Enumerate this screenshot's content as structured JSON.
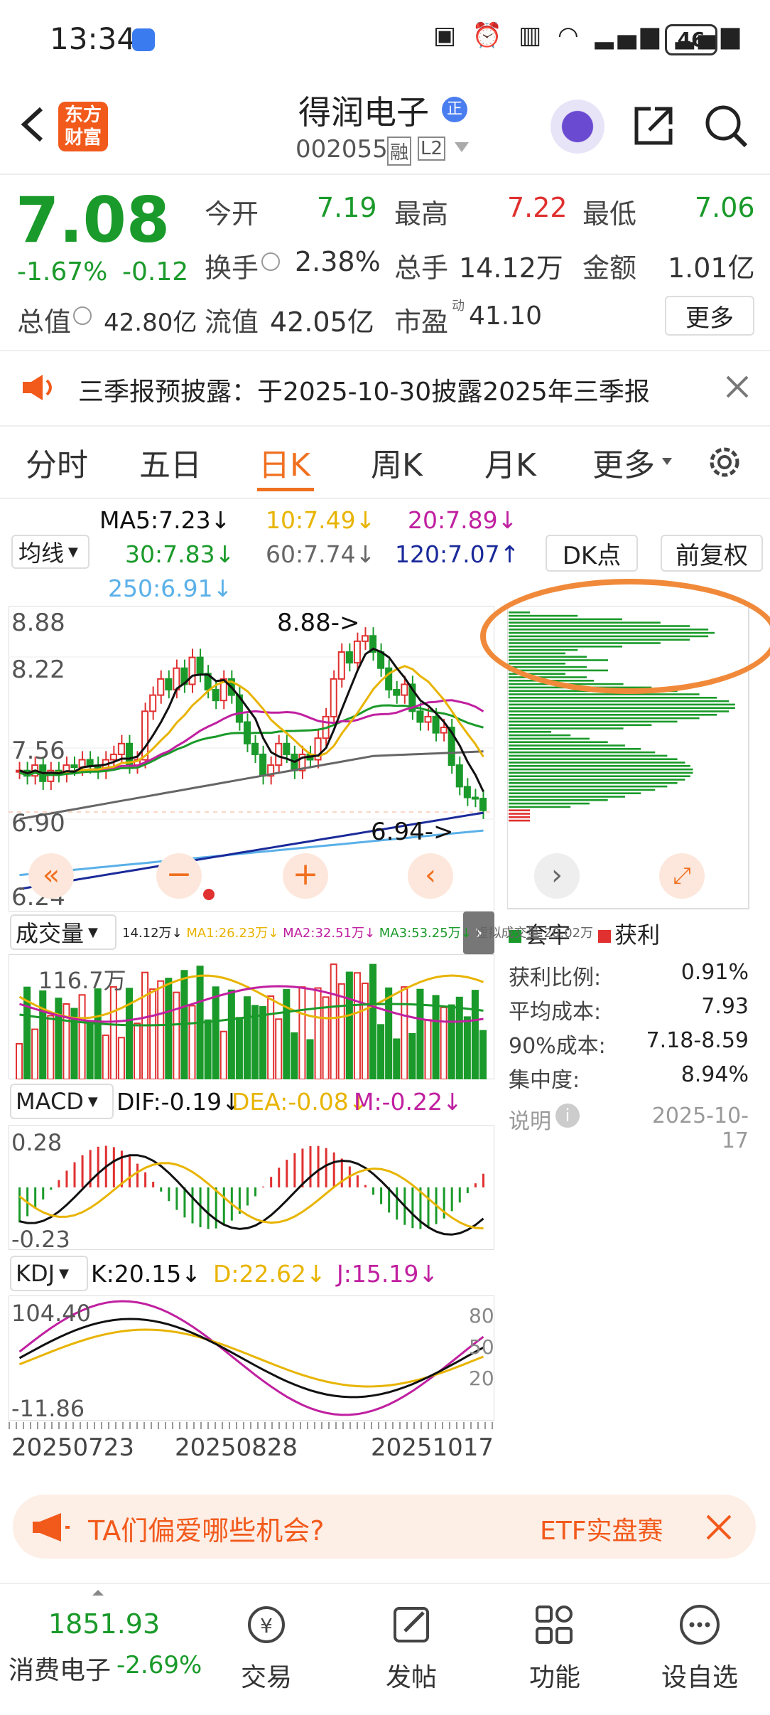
{
  "status_bar": {
    "time": "13:34",
    "battery": "46"
  },
  "header": {
    "app_logo": "东方财富",
    "stock_name": "得润电子",
    "badge": "正",
    "stock_code": "002055",
    "tag_rong": "融",
    "tag_l2": "L2"
  },
  "quote": {
    "price": "7.08",
    "change_pct": "-1.67%",
    "change": "-0.12",
    "open_label": "今开",
    "open": "7.19",
    "high_label": "最高",
    "high": "7.22",
    "low_label": "最低",
    "low": "7.06",
    "turnover_label": "换手",
    "turnover": "2.38%",
    "volume_label": "总手",
    "volume": "14.12万",
    "amount_label": "金额",
    "amount": "1.01亿",
    "mktcap_label": "总值",
    "mktcap": "42.80亿",
    "float_label": "流值",
    "float": "42.05亿",
    "pe_label": "市盈",
    "pe_sup": "动",
    "pe": "41.10",
    "more_button": "更多"
  },
  "notice": {
    "text": "三季报预披露：于2025-10-30披露2025年三季报"
  },
  "tabs": [
    "分时",
    "五日",
    "日K",
    "周K",
    "月K",
    "更多"
  ],
  "active_tab": "日K",
  "ma_legend": {
    "selector": "均线",
    "ma5": "MA5:7.23↓",
    "ma10": "10:7.49↓",
    "ma20": "20:7.89↓",
    "ma30": "30:7.83↓",
    "ma60": "60:7.74↓",
    "ma120": "120:7.07↑",
    "ma250": "250:6.91↓",
    "dk_button": "DK点",
    "fq_button": "前复权"
  },
  "kline": {
    "y_labels": [
      "8.88",
      "8.22",
      "7.56",
      "6.90",
      "6.24"
    ],
    "high_note": "8.88->",
    "low_note": "6.94->"
  },
  "volume": {
    "selector": "成交量",
    "info": "14.12万↓",
    "ma1": "MA1:26.23万↓",
    "ma2": "MA2:32.51万↓",
    "ma3": "MA3:53.25万↓",
    "virtual": "虚拟成交量:20.02万",
    "y_label": "116.7万"
  },
  "macd": {
    "selector": "MACD",
    "dif": "DIF:-0.19↓",
    "dea": "DEA:-0.08↓",
    "m": "M:-0.22↓",
    "y_top": "0.28",
    "y_bottom": "-0.23"
  },
  "kdj": {
    "selector": "KDJ",
    "k": "K:20.15↓",
    "d": "D:22.62↓",
    "j": "J:15.19↓",
    "y_top": "104.40",
    "y_bottom": "-11.86",
    "right_labels": [
      "80",
      "50",
      "20"
    ]
  },
  "x_axis": [
    "20250723",
    "20250828",
    "20251017"
  ],
  "chip": {
    "legend_trapped": "套牢",
    "legend_profit": "获利",
    "rows": [
      {
        "label": "获利比例:",
        "value": "0.91%"
      },
      {
        "label": "平均成本:",
        "value": "7.93"
      },
      {
        "label": "90%成本:",
        "value": "7.18-8.59"
      },
      {
        "label": "集中度:",
        "value": "8.94%"
      }
    ],
    "note_label": "说明",
    "date": "2025-10-17"
  },
  "promo": {
    "text": "TA们偏爱哪些机会?",
    "etf": "ETF实盘赛"
  },
  "bottom": {
    "index_value": "1851.93",
    "index_name": "消费电子",
    "index_change": "-2.69%",
    "nav": [
      "交易",
      "发帖",
      "功能",
      "设自选"
    ]
  },
  "colors": {
    "up": "#e03030",
    "down": "#1a9a2a",
    "accent": "#f07020",
    "ma5": "#111111",
    "ma10": "#e8b400",
    "ma20": "#c020a0",
    "ma30": "#1a9a2a",
    "ma60": "#666666",
    "ma120": "#1a2a9a",
    "ma250": "#5ab0e8"
  }
}
